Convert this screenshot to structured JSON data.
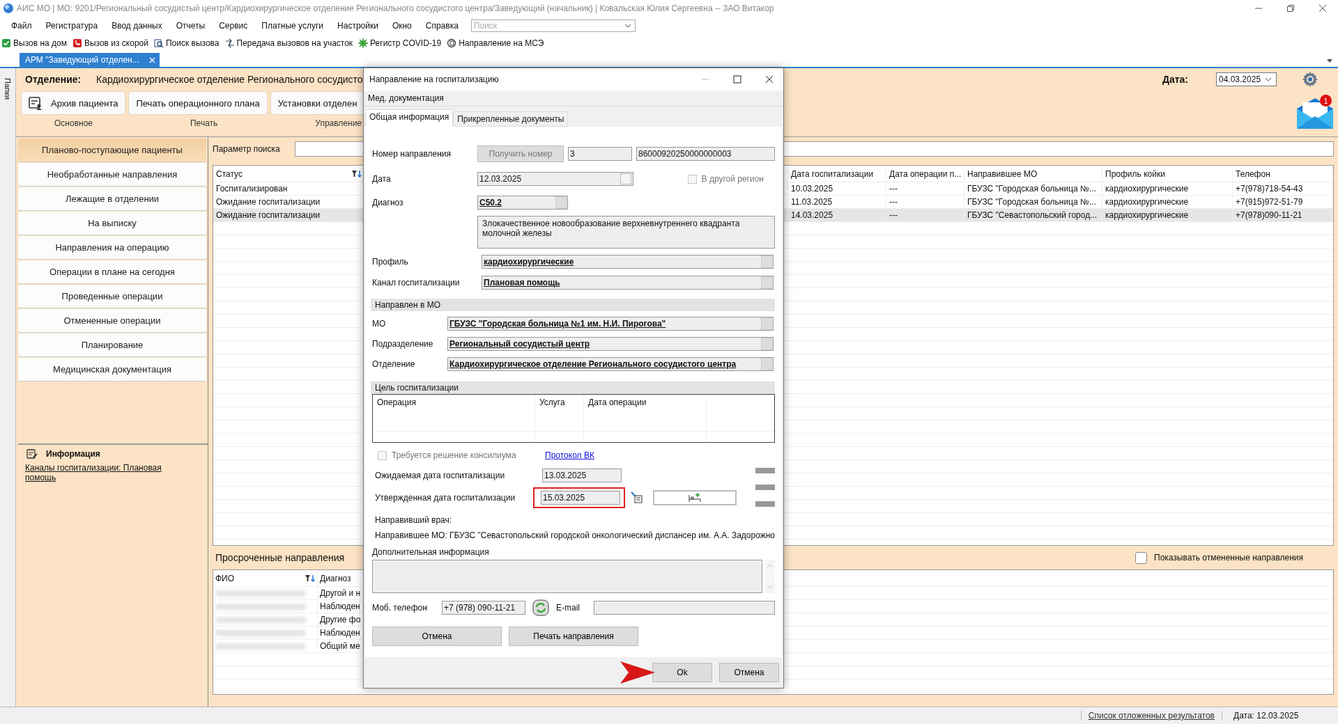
{
  "window": {
    "title": "АИС МО | MO: 9201/Региональный сосудистый центр/Кардиохирургическое отделение Регионального сосудистого центра/Заведующий (начальник) | Ковальская Юлия Сергеевна -- ЗАО Витакор"
  },
  "menu": [
    "Файл",
    "Регистратура",
    "Ввод данных",
    "Отчеты",
    "Сервис",
    "Платные услуги",
    "Настройки",
    "Окно",
    "Справка"
  ],
  "search": {
    "placeholder": "Поиск"
  },
  "toolbar": [
    {
      "label": "Вызов на дом",
      "kind": "check"
    },
    {
      "label": "Вызов из скорой",
      "kind": "phone"
    },
    {
      "label": "Поиск вызова",
      "kind": "search"
    },
    {
      "label": "Передача вызовов на участок",
      "kind": "transfer"
    },
    {
      "label": "Регистр COVID-19",
      "kind": "virus"
    },
    {
      "label": "Направление на МСЭ",
      "kind": "referral"
    }
  ],
  "doc_tab": {
    "label": "АРМ \"Заведующий отделен...",
    "selected": true
  },
  "folders": "Папки",
  "header": {
    "department_label": "Отделение:",
    "department": "Кардиохирургическое отделение Регионального сосудисто",
    "buttons": [
      {
        "label": "Архив пациента",
        "kind": "archive"
      },
      {
        "label": "Печать операционного плана",
        "kind": "plain"
      },
      {
        "label": "Установки отделен",
        "kind": "plain"
      }
    ],
    "groups": [
      "Основное",
      "Печать",
      "Управление"
    ],
    "date_label": "Дата:",
    "date": "04.03.2025",
    "notifications": "1"
  },
  "nav": [
    {
      "label": "Планово-поступающие пациенты",
      "selected": true
    },
    {
      "label": "Необработанные направления",
      "selected": false
    },
    {
      "label": "Лежащие в отделении",
      "selected": false
    },
    {
      "label": "На выписку",
      "selected": false
    },
    {
      "label": "Направления на операцию",
      "selected": false
    },
    {
      "label": "Операции в плане на сегодня",
      "selected": false
    },
    {
      "label": "Проведенные операции",
      "selected": false
    },
    {
      "label": "Отмененные операции",
      "selected": false
    },
    {
      "label": "Планирование",
      "selected": false
    },
    {
      "label": "Медицинская документация",
      "selected": false
    }
  ],
  "info": {
    "title": "Информация",
    "link": "Каналы госпитализации: Плановая помощь"
  },
  "search_param": {
    "label": "Параметр поиска"
  },
  "table": {
    "columns": [
      "Статус",
      "Дата госпитализации",
      "Дата операции п...",
      "Направившее МО",
      "Профиль койки",
      "Телефон"
    ],
    "rows": [
      {
        "cells": [
          "Госпитализирован",
          "10.03.2025",
          "---",
          "ГБУЗС \"Городская больница №...",
          "кардиохирургические",
          "+7(978)718-54-43"
        ],
        "selected": false
      },
      {
        "cells": [
          "Ожидание госпитализации",
          "11.03.2025",
          "---",
          "ГБУЗС \"Городская больница №...",
          "кардиохирургические",
          "+7(915)972-51-79"
        ],
        "selected": false
      },
      {
        "cells": [
          "Ожидание госпитализации",
          "14.03.2025",
          "---",
          "ГБУЗС \"Севастопольский город...",
          "кардиохирургические",
          "+7(978)090-11-21"
        ],
        "selected": true
      }
    ]
  },
  "overdue": {
    "title": "Просроченные направления",
    "show_cancelled": {
      "label": "Показывать отмененные направления",
      "checked": false
    },
    "columns": [
      "ФИО",
      "Диагноз"
    ],
    "rows": [
      {
        "diagnosis": "Другой и н"
      },
      {
        "diagnosis": "Наблюден"
      },
      {
        "diagnosis": "Другие фо"
      },
      {
        "diagnosis": "Наблюден"
      },
      {
        "diagnosis": "Общий ме"
      }
    ]
  },
  "status_bar": {
    "link": "Список отложенных результатов",
    "date": "Дата: 12.03.2025"
  },
  "dialog": {
    "title": "Направление на госпитализацию",
    "menu": "Мед. документация",
    "tabs": [
      {
        "label": "Общая информация",
        "selected": true
      },
      {
        "label": "Прикрепленные документы",
        "selected": false
      }
    ],
    "number": {
      "label": "Номер направления",
      "button": {
        "label": "Получить номер",
        "disabled": true
      },
      "short": "3",
      "full": "86000920250000000003"
    },
    "date": {
      "label": "Дата",
      "value": "12.03.2025"
    },
    "other_region": {
      "label": "В другой регион",
      "checked": false,
      "disabled": true
    },
    "diagnosis": {
      "label": "Диагноз",
      "code": "C50.2",
      "text": "Злокачественное новообразование верхневнутреннего квадранта молочной железы"
    },
    "fields": [
      {
        "label": "Профиль",
        "value": "кардиохирургические"
      },
      {
        "label": "Канал госпитализации",
        "value": "Плановая помощь"
      }
    ],
    "mo_section": {
      "title": "Направлен в МО",
      "fields": [
        {
          "label": "МО",
          "value": "ГБУЗС \"Городская больница №1 им. Н.И. Пирогова\""
        },
        {
          "label": "Подразделение",
          "value": "Региональный сосудистый центр"
        },
        {
          "label": "Отделение",
          "value": "Кардиохирургическое отделение Регионального сосудистого центра"
        }
      ]
    },
    "goal_section": {
      "title": "Цель госпитализации",
      "columns": [
        "Операция",
        "Услуга",
        "Дата операции"
      ]
    },
    "council": {
      "label": "Требуется решение консилиума",
      "checked": false,
      "disabled": true
    },
    "protocol_link": "Протокол ВК",
    "expected_date": {
      "label": "Ожидаемая дата госпитализации",
      "value": "13.03.2025"
    },
    "approved_date": {
      "label": "Утвержденная дата госпитализации",
      "value": "15.03.2025",
      "highlighted": true
    },
    "doctor_label": "Направивший врач:",
    "referring_mo": "Направившее МО: ГБУЗС \"Севастопольский городской онкологический диспансер им. А.А. Задорожно",
    "extra_info": {
      "label": "Дополнительная информация"
    },
    "phone": {
      "label": "Моб. телефон",
      "value": "+7 (978) 090-11-21"
    },
    "email": {
      "label": "E-mail"
    },
    "buttons": [
      "Отмена",
      "Печать направления"
    ],
    "footer_buttons": [
      {
        "label": "Ok",
        "pointed": true
      },
      {
        "label": "Отмена",
        "pointed": false
      }
    ]
  }
}
